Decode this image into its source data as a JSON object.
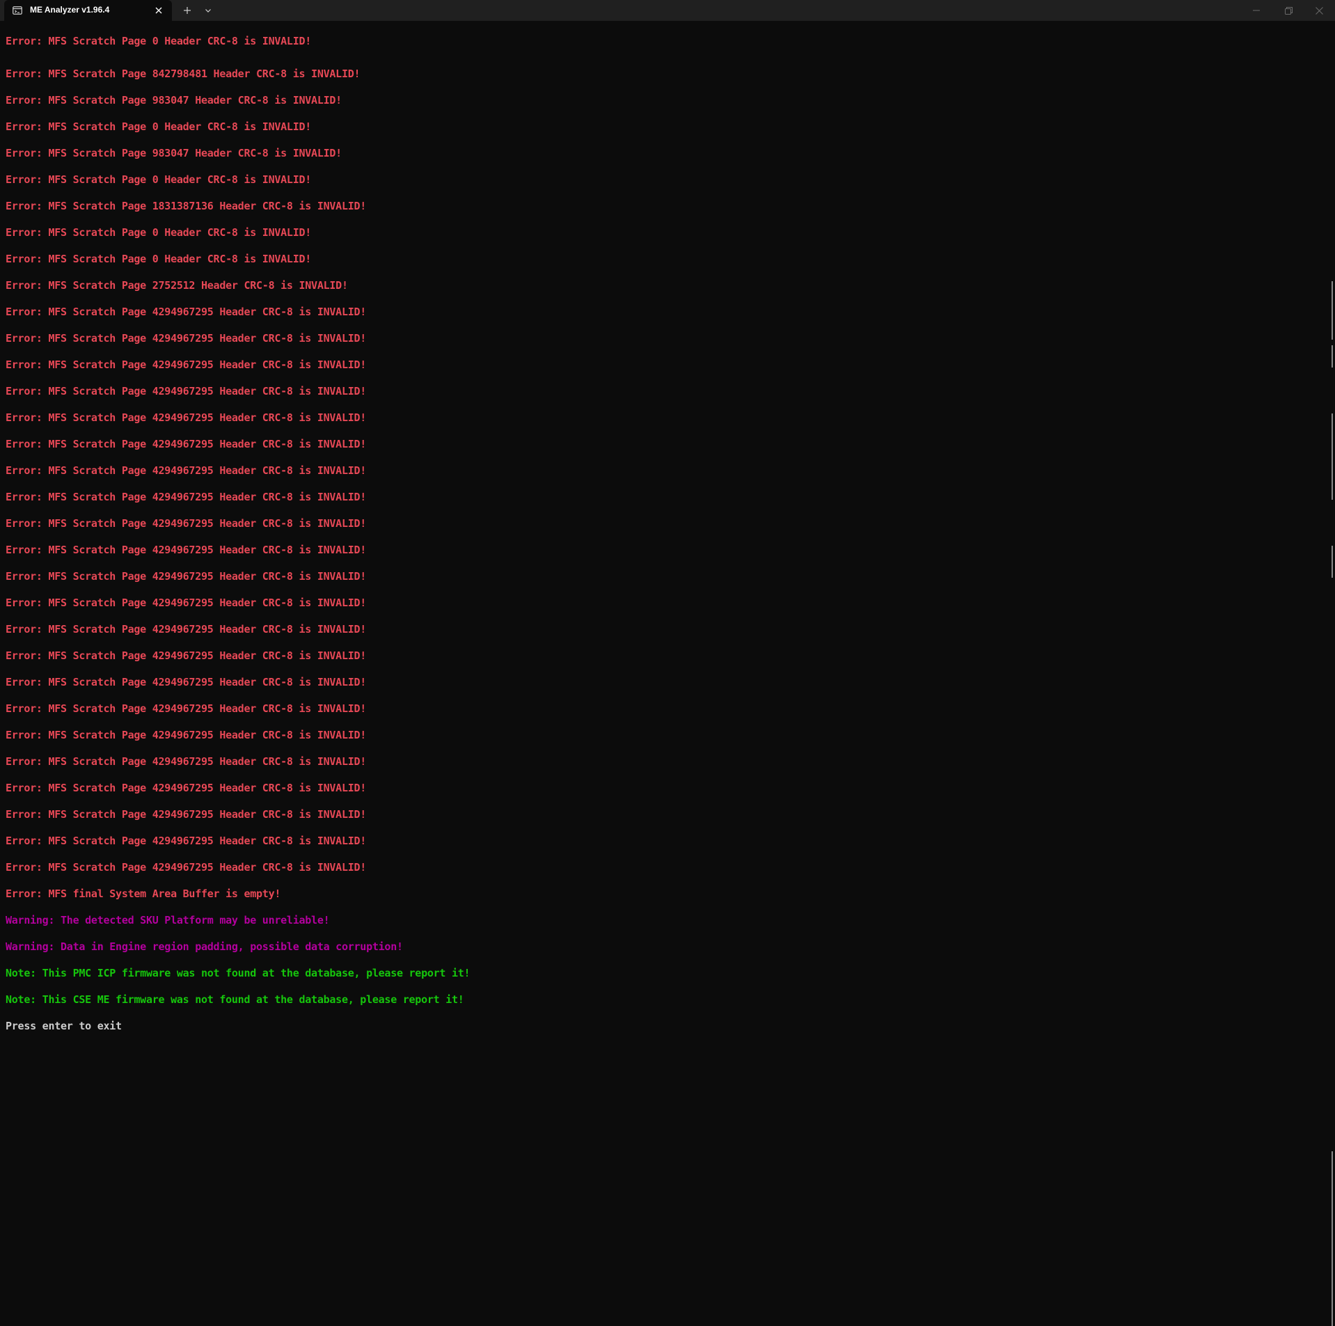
{
  "window": {
    "tab_title": "ME Analyzer v1.96.4",
    "icons": {
      "tab": "terminal-icon",
      "close_tab": "close-icon",
      "new_tab": "plus-icon",
      "dropdown": "chevron-down-icon",
      "minimize": "minimize-icon",
      "maximize": "restore-icon",
      "close_window": "close-icon"
    }
  },
  "colors": {
    "error": "#e74856",
    "warning": "#b4009e",
    "note": "#16c60c",
    "plain": "#cccccc",
    "background": "#0c0c0c"
  },
  "console": {
    "lines": [
      {
        "type": "error",
        "text": "Error: MFS Scratch Page 0 Header CRC-8 is INVALID!"
      },
      {
        "type": "error",
        "text": "Error: MFS Scratch Page 842798481 Header CRC-8 is INVALID!"
      },
      {
        "type": "error",
        "text": "Error: MFS Scratch Page 983047 Header CRC-8 is INVALID!"
      },
      {
        "type": "error",
        "text": "Error: MFS Scratch Page 0 Header CRC-8 is INVALID!"
      },
      {
        "type": "error",
        "text": "Error: MFS Scratch Page 983047 Header CRC-8 is INVALID!"
      },
      {
        "type": "error",
        "text": "Error: MFS Scratch Page 0 Header CRC-8 is INVALID!"
      },
      {
        "type": "error",
        "text": "Error: MFS Scratch Page 1831387136 Header CRC-8 is INVALID!"
      },
      {
        "type": "error",
        "text": "Error: MFS Scratch Page 0 Header CRC-8 is INVALID!"
      },
      {
        "type": "error",
        "text": "Error: MFS Scratch Page 0 Header CRC-8 is INVALID!"
      },
      {
        "type": "error",
        "text": "Error: MFS Scratch Page 2752512 Header CRC-8 is INVALID!"
      },
      {
        "type": "error",
        "text": "Error: MFS Scratch Page 4294967295 Header CRC-8 is INVALID!"
      },
      {
        "type": "error",
        "text": "Error: MFS Scratch Page 4294967295 Header CRC-8 is INVALID!"
      },
      {
        "type": "error",
        "text": "Error: MFS Scratch Page 4294967295 Header CRC-8 is INVALID!"
      },
      {
        "type": "error",
        "text": "Error: MFS Scratch Page 4294967295 Header CRC-8 is INVALID!"
      },
      {
        "type": "error",
        "text": "Error: MFS Scratch Page 4294967295 Header CRC-8 is INVALID!"
      },
      {
        "type": "error",
        "text": "Error: MFS Scratch Page 4294967295 Header CRC-8 is INVALID!"
      },
      {
        "type": "error",
        "text": "Error: MFS Scratch Page 4294967295 Header CRC-8 is INVALID!"
      },
      {
        "type": "error",
        "text": "Error: MFS Scratch Page 4294967295 Header CRC-8 is INVALID!"
      },
      {
        "type": "error",
        "text": "Error: MFS Scratch Page 4294967295 Header CRC-8 is INVALID!"
      },
      {
        "type": "error",
        "text": "Error: MFS Scratch Page 4294967295 Header CRC-8 is INVALID!"
      },
      {
        "type": "error",
        "text": "Error: MFS Scratch Page 4294967295 Header CRC-8 is INVALID!"
      },
      {
        "type": "error",
        "text": "Error: MFS Scratch Page 4294967295 Header CRC-8 is INVALID!"
      },
      {
        "type": "error",
        "text": "Error: MFS Scratch Page 4294967295 Header CRC-8 is INVALID!"
      },
      {
        "type": "error",
        "text": "Error: MFS Scratch Page 4294967295 Header CRC-8 is INVALID!"
      },
      {
        "type": "error",
        "text": "Error: MFS Scratch Page 4294967295 Header CRC-8 is INVALID!"
      },
      {
        "type": "error",
        "text": "Error: MFS Scratch Page 4294967295 Header CRC-8 is INVALID!"
      },
      {
        "type": "error",
        "text": "Error: MFS Scratch Page 4294967295 Header CRC-8 is INVALID!"
      },
      {
        "type": "error",
        "text": "Error: MFS Scratch Page 4294967295 Header CRC-8 is INVALID!"
      },
      {
        "type": "error",
        "text": "Error: MFS Scratch Page 4294967295 Header CRC-8 is INVALID!"
      },
      {
        "type": "error",
        "text": "Error: MFS Scratch Page 4294967295 Header CRC-8 is INVALID!"
      },
      {
        "type": "error",
        "text": "Error: MFS Scratch Page 4294967295 Header CRC-8 is INVALID!"
      },
      {
        "type": "error",
        "text": "Error: MFS Scratch Page 4294967295 Header CRC-8 is INVALID!"
      },
      {
        "type": "error",
        "text": "Error: MFS final System Area Buffer is empty!"
      },
      {
        "type": "warning",
        "text": "Warning: The detected SKU Platform may be unreliable!"
      },
      {
        "type": "warning",
        "text": "Warning: Data in Engine region padding, possible data corruption!"
      },
      {
        "type": "note",
        "text": "Note: This PMC ICP firmware was not found at the database, please report it!"
      },
      {
        "type": "note",
        "text": "Note: This CSE ME firmware was not found at the database, please report it!"
      },
      {
        "type": "plain",
        "text": "Press enter to exit"
      }
    ]
  }
}
